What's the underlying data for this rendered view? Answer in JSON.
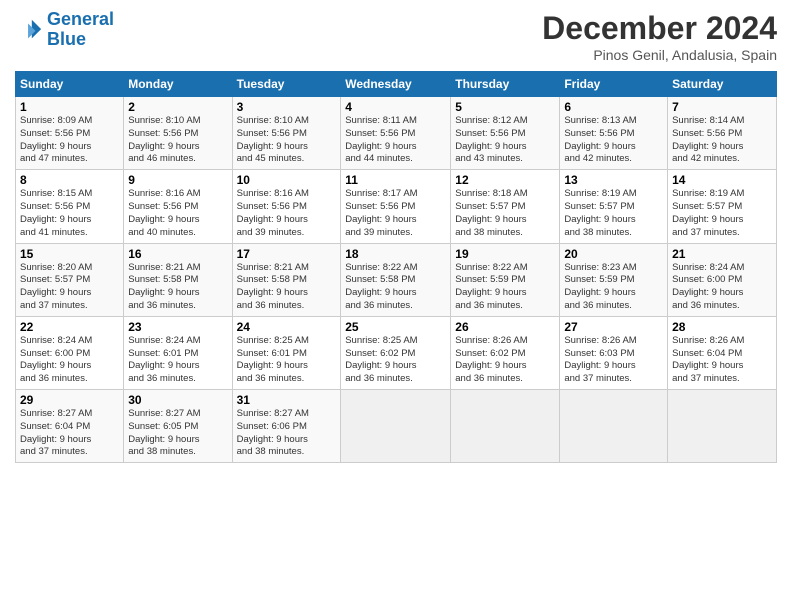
{
  "logo": {
    "line1": "General",
    "line2": "Blue"
  },
  "title": "December 2024",
  "subtitle": "Pinos Genil, Andalusia, Spain",
  "days_of_week": [
    "Sunday",
    "Monday",
    "Tuesday",
    "Wednesday",
    "Thursday",
    "Friday",
    "Saturday"
  ],
  "weeks": [
    [
      {
        "day": "1",
        "info": "Sunrise: 8:09 AM\nSunset: 5:56 PM\nDaylight: 9 hours\nand 47 minutes."
      },
      {
        "day": "2",
        "info": "Sunrise: 8:10 AM\nSunset: 5:56 PM\nDaylight: 9 hours\nand 46 minutes."
      },
      {
        "day": "3",
        "info": "Sunrise: 8:10 AM\nSunset: 5:56 PM\nDaylight: 9 hours\nand 45 minutes."
      },
      {
        "day": "4",
        "info": "Sunrise: 8:11 AM\nSunset: 5:56 PM\nDaylight: 9 hours\nand 44 minutes."
      },
      {
        "day": "5",
        "info": "Sunrise: 8:12 AM\nSunset: 5:56 PM\nDaylight: 9 hours\nand 43 minutes."
      },
      {
        "day": "6",
        "info": "Sunrise: 8:13 AM\nSunset: 5:56 PM\nDaylight: 9 hours\nand 42 minutes."
      },
      {
        "day": "7",
        "info": "Sunrise: 8:14 AM\nSunset: 5:56 PM\nDaylight: 9 hours\nand 42 minutes."
      }
    ],
    [
      {
        "day": "8",
        "info": "Sunrise: 8:15 AM\nSunset: 5:56 PM\nDaylight: 9 hours\nand 41 minutes."
      },
      {
        "day": "9",
        "info": "Sunrise: 8:16 AM\nSunset: 5:56 PM\nDaylight: 9 hours\nand 40 minutes."
      },
      {
        "day": "10",
        "info": "Sunrise: 8:16 AM\nSunset: 5:56 PM\nDaylight: 9 hours\nand 39 minutes."
      },
      {
        "day": "11",
        "info": "Sunrise: 8:17 AM\nSunset: 5:56 PM\nDaylight: 9 hours\nand 39 minutes."
      },
      {
        "day": "12",
        "info": "Sunrise: 8:18 AM\nSunset: 5:57 PM\nDaylight: 9 hours\nand 38 minutes."
      },
      {
        "day": "13",
        "info": "Sunrise: 8:19 AM\nSunset: 5:57 PM\nDaylight: 9 hours\nand 38 minutes."
      },
      {
        "day": "14",
        "info": "Sunrise: 8:19 AM\nSunset: 5:57 PM\nDaylight: 9 hours\nand 37 minutes."
      }
    ],
    [
      {
        "day": "15",
        "info": "Sunrise: 8:20 AM\nSunset: 5:57 PM\nDaylight: 9 hours\nand 37 minutes."
      },
      {
        "day": "16",
        "info": "Sunrise: 8:21 AM\nSunset: 5:58 PM\nDaylight: 9 hours\nand 36 minutes."
      },
      {
        "day": "17",
        "info": "Sunrise: 8:21 AM\nSunset: 5:58 PM\nDaylight: 9 hours\nand 36 minutes."
      },
      {
        "day": "18",
        "info": "Sunrise: 8:22 AM\nSunset: 5:58 PM\nDaylight: 9 hours\nand 36 minutes."
      },
      {
        "day": "19",
        "info": "Sunrise: 8:22 AM\nSunset: 5:59 PM\nDaylight: 9 hours\nand 36 minutes."
      },
      {
        "day": "20",
        "info": "Sunrise: 8:23 AM\nSunset: 5:59 PM\nDaylight: 9 hours\nand 36 minutes."
      },
      {
        "day": "21",
        "info": "Sunrise: 8:24 AM\nSunset: 6:00 PM\nDaylight: 9 hours\nand 36 minutes."
      }
    ],
    [
      {
        "day": "22",
        "info": "Sunrise: 8:24 AM\nSunset: 6:00 PM\nDaylight: 9 hours\nand 36 minutes."
      },
      {
        "day": "23",
        "info": "Sunrise: 8:24 AM\nSunset: 6:01 PM\nDaylight: 9 hours\nand 36 minutes."
      },
      {
        "day": "24",
        "info": "Sunrise: 8:25 AM\nSunset: 6:01 PM\nDaylight: 9 hours\nand 36 minutes."
      },
      {
        "day": "25",
        "info": "Sunrise: 8:25 AM\nSunset: 6:02 PM\nDaylight: 9 hours\nand 36 minutes."
      },
      {
        "day": "26",
        "info": "Sunrise: 8:26 AM\nSunset: 6:02 PM\nDaylight: 9 hours\nand 36 minutes."
      },
      {
        "day": "27",
        "info": "Sunrise: 8:26 AM\nSunset: 6:03 PM\nDaylight: 9 hours\nand 37 minutes."
      },
      {
        "day": "28",
        "info": "Sunrise: 8:26 AM\nSunset: 6:04 PM\nDaylight: 9 hours\nand 37 minutes."
      }
    ],
    [
      {
        "day": "29",
        "info": "Sunrise: 8:27 AM\nSunset: 6:04 PM\nDaylight: 9 hours\nand 37 minutes."
      },
      {
        "day": "30",
        "info": "Sunrise: 8:27 AM\nSunset: 6:05 PM\nDaylight: 9 hours\nand 38 minutes."
      },
      {
        "day": "31",
        "info": "Sunrise: 8:27 AM\nSunset: 6:06 PM\nDaylight: 9 hours\nand 38 minutes."
      },
      null,
      null,
      null,
      null
    ]
  ]
}
